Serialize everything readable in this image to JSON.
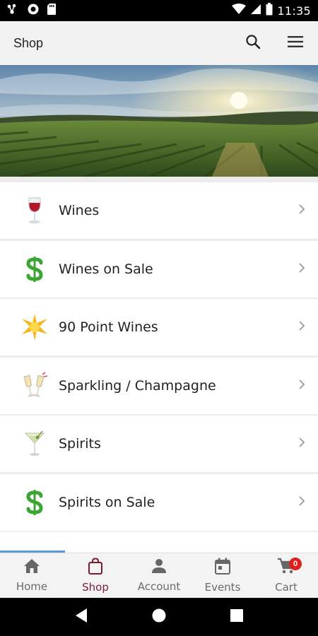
{
  "status_bar": {
    "time": "11:35",
    "icons": [
      "network-share-icon",
      "circle-app-icon",
      "sd-card-icon",
      "wifi-icon",
      "signal-icon",
      "battery-icon"
    ]
  },
  "app_bar": {
    "title": "Shop",
    "actions": [
      "search-icon",
      "menu-icon"
    ]
  },
  "hero": {
    "description_icon": "vineyard-banner"
  },
  "list": {
    "items": [
      {
        "label": "Wines",
        "icon": "wine-glass-icon"
      },
      {
        "label": "Wines on Sale",
        "icon": "dollar-icon"
      },
      {
        "label": "90 Point Wines",
        "icon": "star-icon"
      },
      {
        "label": "Sparkling / Champagne",
        "icon": "champagne-icon"
      },
      {
        "label": "Spirits",
        "icon": "cocktail-icon"
      },
      {
        "label": "Spirits on Sale",
        "icon": "dollar-icon"
      }
    ]
  },
  "bottom_nav": {
    "items": [
      {
        "label": "Home",
        "icon": "home-icon"
      },
      {
        "label": "Shop",
        "icon": "shopping-bag-icon",
        "active": true
      },
      {
        "label": "Account",
        "icon": "person-icon"
      },
      {
        "label": "Events",
        "icon": "calendar-icon"
      },
      {
        "label": "Cart",
        "icon": "cart-icon",
        "badge": "0"
      }
    ]
  },
  "colors": {
    "accent": "#7a1b2f",
    "badge": "#e0201e",
    "dollar_green": "#3aa533",
    "app_bar_bg": "#f2f2f2"
  }
}
